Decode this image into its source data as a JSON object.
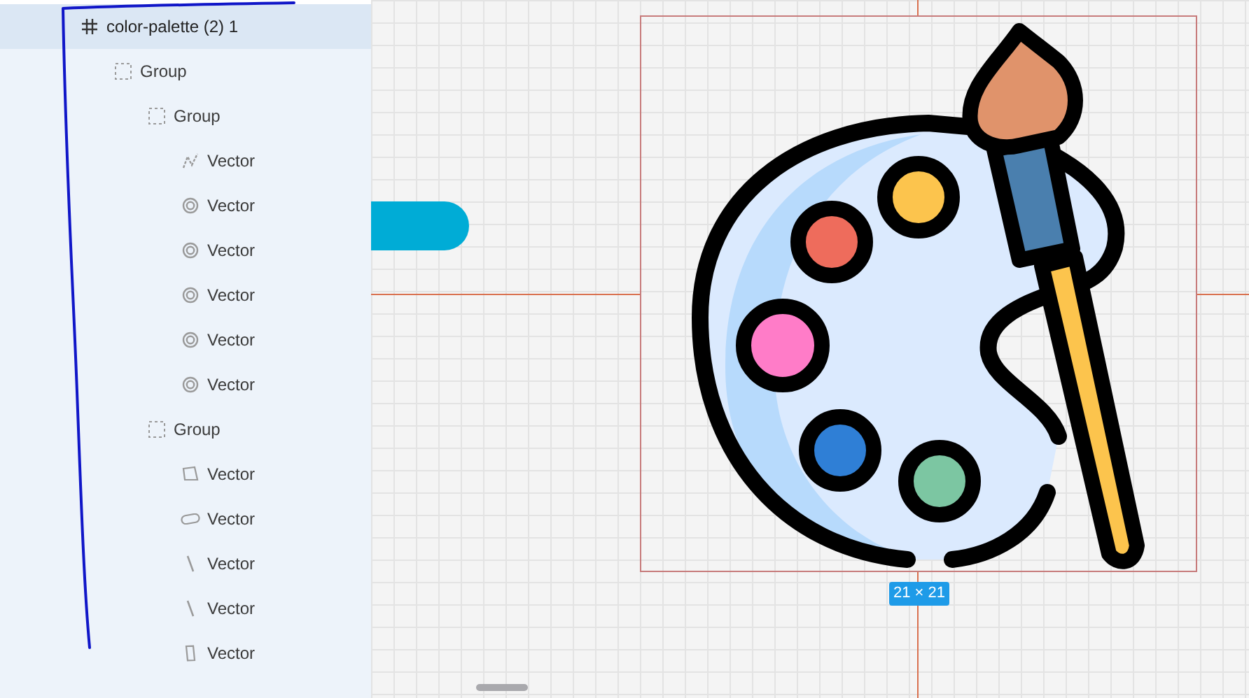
{
  "layers": [
    {
      "label": "color-palette (2) 1",
      "kind": "frame",
      "selected": true,
      "children": [
        {
          "label": "Group",
          "kind": "group",
          "selected": false,
          "children": [
            {
              "label": "Group",
              "kind": "group",
              "selected": false,
              "children": [
                {
                  "label": "Vector",
                  "kind": "path",
                  "selected": false
                },
                {
                  "label": "Vector",
                  "kind": "ellipse",
                  "selected": false
                },
                {
                  "label": "Vector",
                  "kind": "ellipse",
                  "selected": false
                },
                {
                  "label": "Vector",
                  "kind": "ellipse",
                  "selected": false
                },
                {
                  "label": "Vector",
                  "kind": "ellipse",
                  "selected": false
                },
                {
                  "label": "Vector",
                  "kind": "ellipse",
                  "selected": false
                }
              ]
            },
            {
              "label": "Group",
              "kind": "group",
              "selected": false,
              "children": [
                {
                  "label": "Vector",
                  "kind": "quad",
                  "selected": false
                },
                {
                  "label": "Vector",
                  "kind": "pill",
                  "selected": false
                },
                {
                  "label": "Vector",
                  "kind": "line",
                  "selected": false
                },
                {
                  "label": "Vector",
                  "kind": "line",
                  "selected": false
                },
                {
                  "label": "Vector",
                  "kind": "bar",
                  "selected": false
                }
              ]
            }
          ]
        }
      ]
    }
  ],
  "canvas": {
    "size_badge": "21 × 21"
  }
}
